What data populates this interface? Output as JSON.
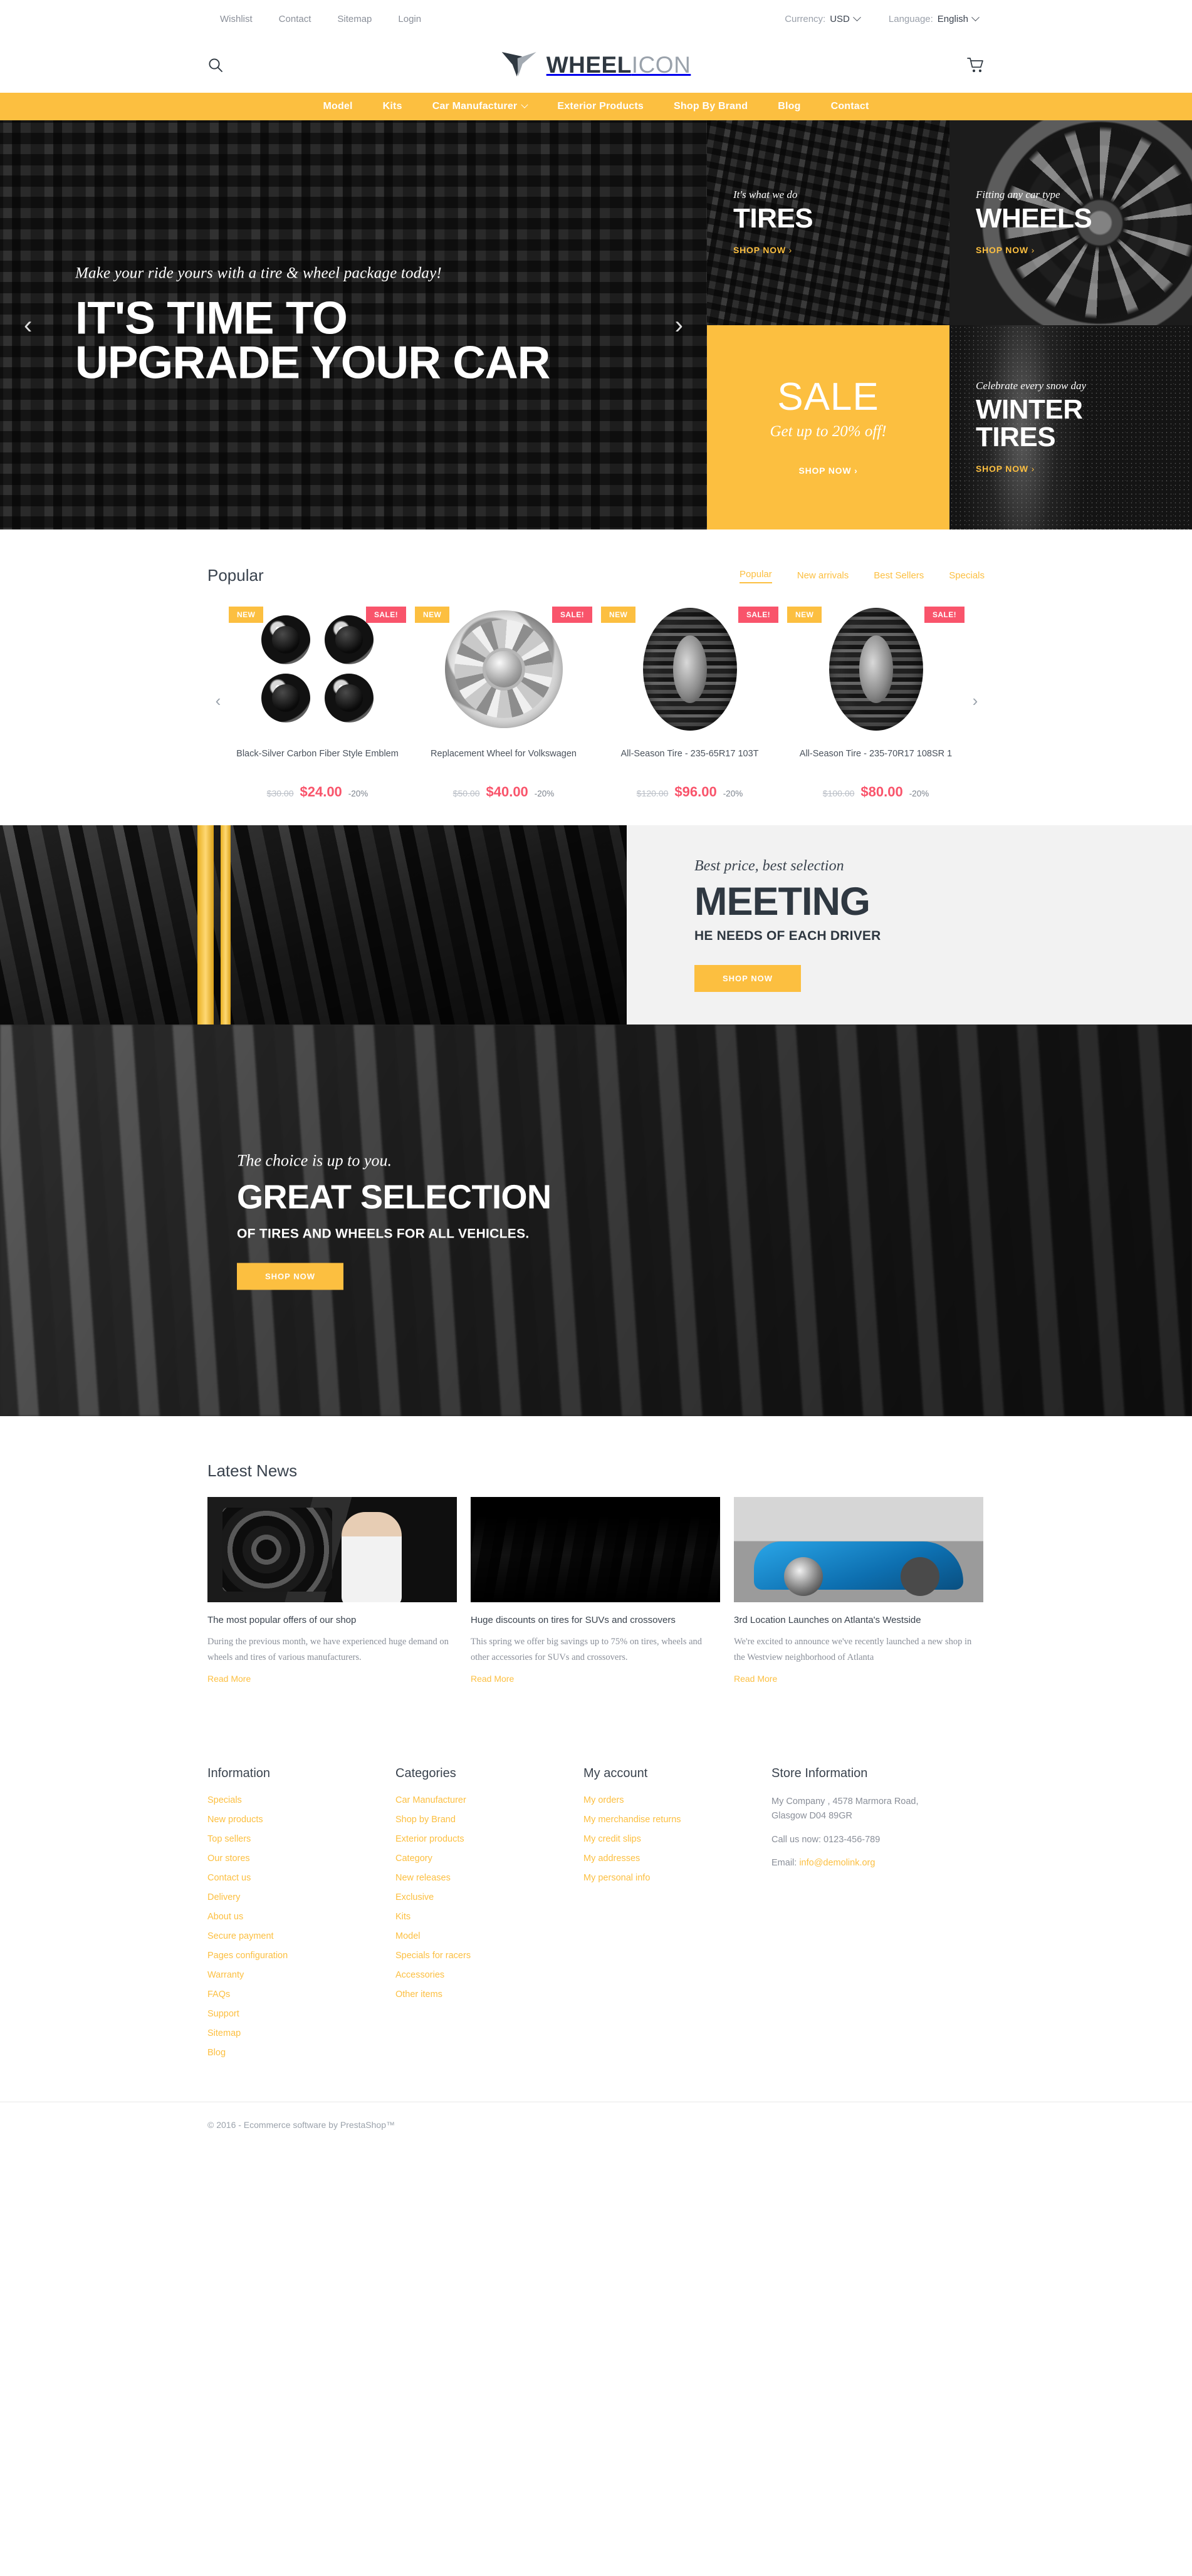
{
  "topbar": {
    "links": [
      {
        "label": "Wishlist"
      },
      {
        "label": "Contact"
      },
      {
        "label": "Sitemap"
      },
      {
        "label": "Login"
      }
    ],
    "currency_label": "Currency:",
    "currency_value": "USD",
    "language_label": "Language:",
    "language_value": "English"
  },
  "header": {
    "logo_primary": "WHEEL",
    "logo_secondary": "ICON",
    "search_icon": "search-icon",
    "cart_icon": "cart-icon"
  },
  "nav": {
    "items": [
      {
        "label": "Model",
        "has_caret": false
      },
      {
        "label": "Kits",
        "has_caret": false
      },
      {
        "label": "Car Manufacturer",
        "has_caret": true
      },
      {
        "label": "Exterior Products",
        "has_caret": false
      },
      {
        "label": "Shop By Brand",
        "has_caret": false
      },
      {
        "label": "Blog",
        "has_caret": false
      },
      {
        "label": "Contact",
        "has_caret": false
      }
    ]
  },
  "hero": {
    "subtitle": "Make your ride yours with a tire & wheel package today!",
    "title_line1": "IT'S TIME TO",
    "title_line2": "UPGRADE YOUR CAR",
    "prev_arrow": "‹",
    "next_arrow": "›"
  },
  "promo_tiles": [
    {
      "subtitle": "It's what we do",
      "title": "TIRES",
      "link": "SHOP NOW"
    },
    {
      "subtitle": "Fitting any car type",
      "title": "WHEELS",
      "link": "SHOP NOW"
    },
    {
      "subtitle": "Get up to 20% off!",
      "title": "SALE",
      "link": "SHOP NOW"
    },
    {
      "subtitle": "Celebrate every snow day",
      "title_line1": "WINTER",
      "title_line2": "TIRES",
      "link": "SHOP NOW"
    }
  ],
  "popular": {
    "heading": "Popular",
    "tabs": [
      {
        "label": "Popular",
        "active": true
      },
      {
        "label": "New arrivals",
        "active": false
      },
      {
        "label": "Best Sellers",
        "active": false
      },
      {
        "label": "Specials",
        "active": false
      }
    ],
    "prev_arrow": "‹",
    "next_arrow": "›",
    "badge_new": "NEW",
    "badge_sale": "SALE!",
    "products": [
      {
        "name": "Black-Silver Carbon Fiber Style Emblem",
        "old_price": "$30.00",
        "price": "$24.00",
        "discount": "-20%",
        "badges": [
          "NEW",
          "SALE!"
        ]
      },
      {
        "name": "Replacement Wheel for Volkswagen",
        "old_price": "$50.00",
        "price": "$40.00",
        "discount": "-20%",
        "badges": [
          "NEW",
          "SALE!"
        ]
      },
      {
        "name": "All-Season Tire - 235-65R17 103T",
        "old_price": "$120.00",
        "price": "$96.00",
        "discount": "-20%",
        "badges": [
          "NEW",
          "SALE!"
        ]
      },
      {
        "name": "All-Season Tire - 235-70R17 108SR 1",
        "old_price": "$100.00",
        "price": "$80.00",
        "discount": "-20%",
        "badges": [
          "NEW",
          "SALE!"
        ]
      }
    ]
  },
  "meeting": {
    "subtitle": "Best price, best selection",
    "title": "MEETING",
    "line": "HE NEEDS OF EACH DRIVER",
    "button": "SHOP NOW"
  },
  "great": {
    "subtitle": "The choice is up to you.",
    "title": "GREAT SELECTION",
    "line": "OF TIRES AND WHEELS FOR ALL VEHICLES.",
    "button": "SHOP NOW"
  },
  "news": {
    "heading": "Latest News",
    "items": [
      {
        "title": "The most popular offers of our shop",
        "text": "During the previous month, we have experienced huge demand on wheels and tires of various manufacturers.",
        "link": "Read More"
      },
      {
        "title": "Huge discounts on tires for SUVs and crossovers",
        "text": "This spring we offer big savings up to 75% on tires, wheels and other accessories for SUVs and crossovers.",
        "link": "Read More"
      },
      {
        "title": "3rd Location Launches on Atlanta's Westside",
        "text": "We're excited to announce we've recently launched a new shop in the Westview neighborhood of Atlanta",
        "link": "Read More"
      }
    ]
  },
  "footer": {
    "information": {
      "heading": "Information",
      "links": [
        {
          "label": "Specials"
        },
        {
          "label": "New products"
        },
        {
          "label": "Top sellers"
        },
        {
          "label": "Our stores"
        },
        {
          "label": "Contact us"
        },
        {
          "label": "Delivery"
        },
        {
          "label": "About us"
        },
        {
          "label": "Secure payment"
        },
        {
          "label": "Pages configuration"
        },
        {
          "label": "Warranty"
        },
        {
          "label": "FAQs"
        },
        {
          "label": "Support"
        },
        {
          "label": "Sitemap"
        },
        {
          "label": "Blog"
        }
      ]
    },
    "categories": {
      "heading": "Categories",
      "links": [
        {
          "label": "Car Manufacturer"
        },
        {
          "label": "Shop by Brand"
        },
        {
          "label": "Exterior products"
        },
        {
          "label": "Category"
        },
        {
          "label": "New releases"
        },
        {
          "label": "Exclusive"
        },
        {
          "label": "Kits"
        },
        {
          "label": "Model"
        },
        {
          "label": "Specials for racers"
        },
        {
          "label": "Accessories"
        },
        {
          "label": "Other items"
        }
      ]
    },
    "account": {
      "heading": "My account",
      "links": [
        {
          "label": "My orders"
        },
        {
          "label": "My merchandise returns"
        },
        {
          "label": "My credit slips"
        },
        {
          "label": "My addresses"
        },
        {
          "label": "My personal info"
        }
      ]
    },
    "store": {
      "heading": "Store Information",
      "address_line1": "My Company , 4578 Marmora Road,",
      "address_line2": "Glasgow D04 89GR",
      "phone": "Call us now: 0123-456-789",
      "email_label": "Email:",
      "email": "info@demolink.org"
    },
    "copyright": "© 2016 - Ecommerce software by PrestaShop™"
  },
  "colors": {
    "accent": "#fcbf40",
    "sale": "#f9546b",
    "dark": "#2f3841"
  }
}
